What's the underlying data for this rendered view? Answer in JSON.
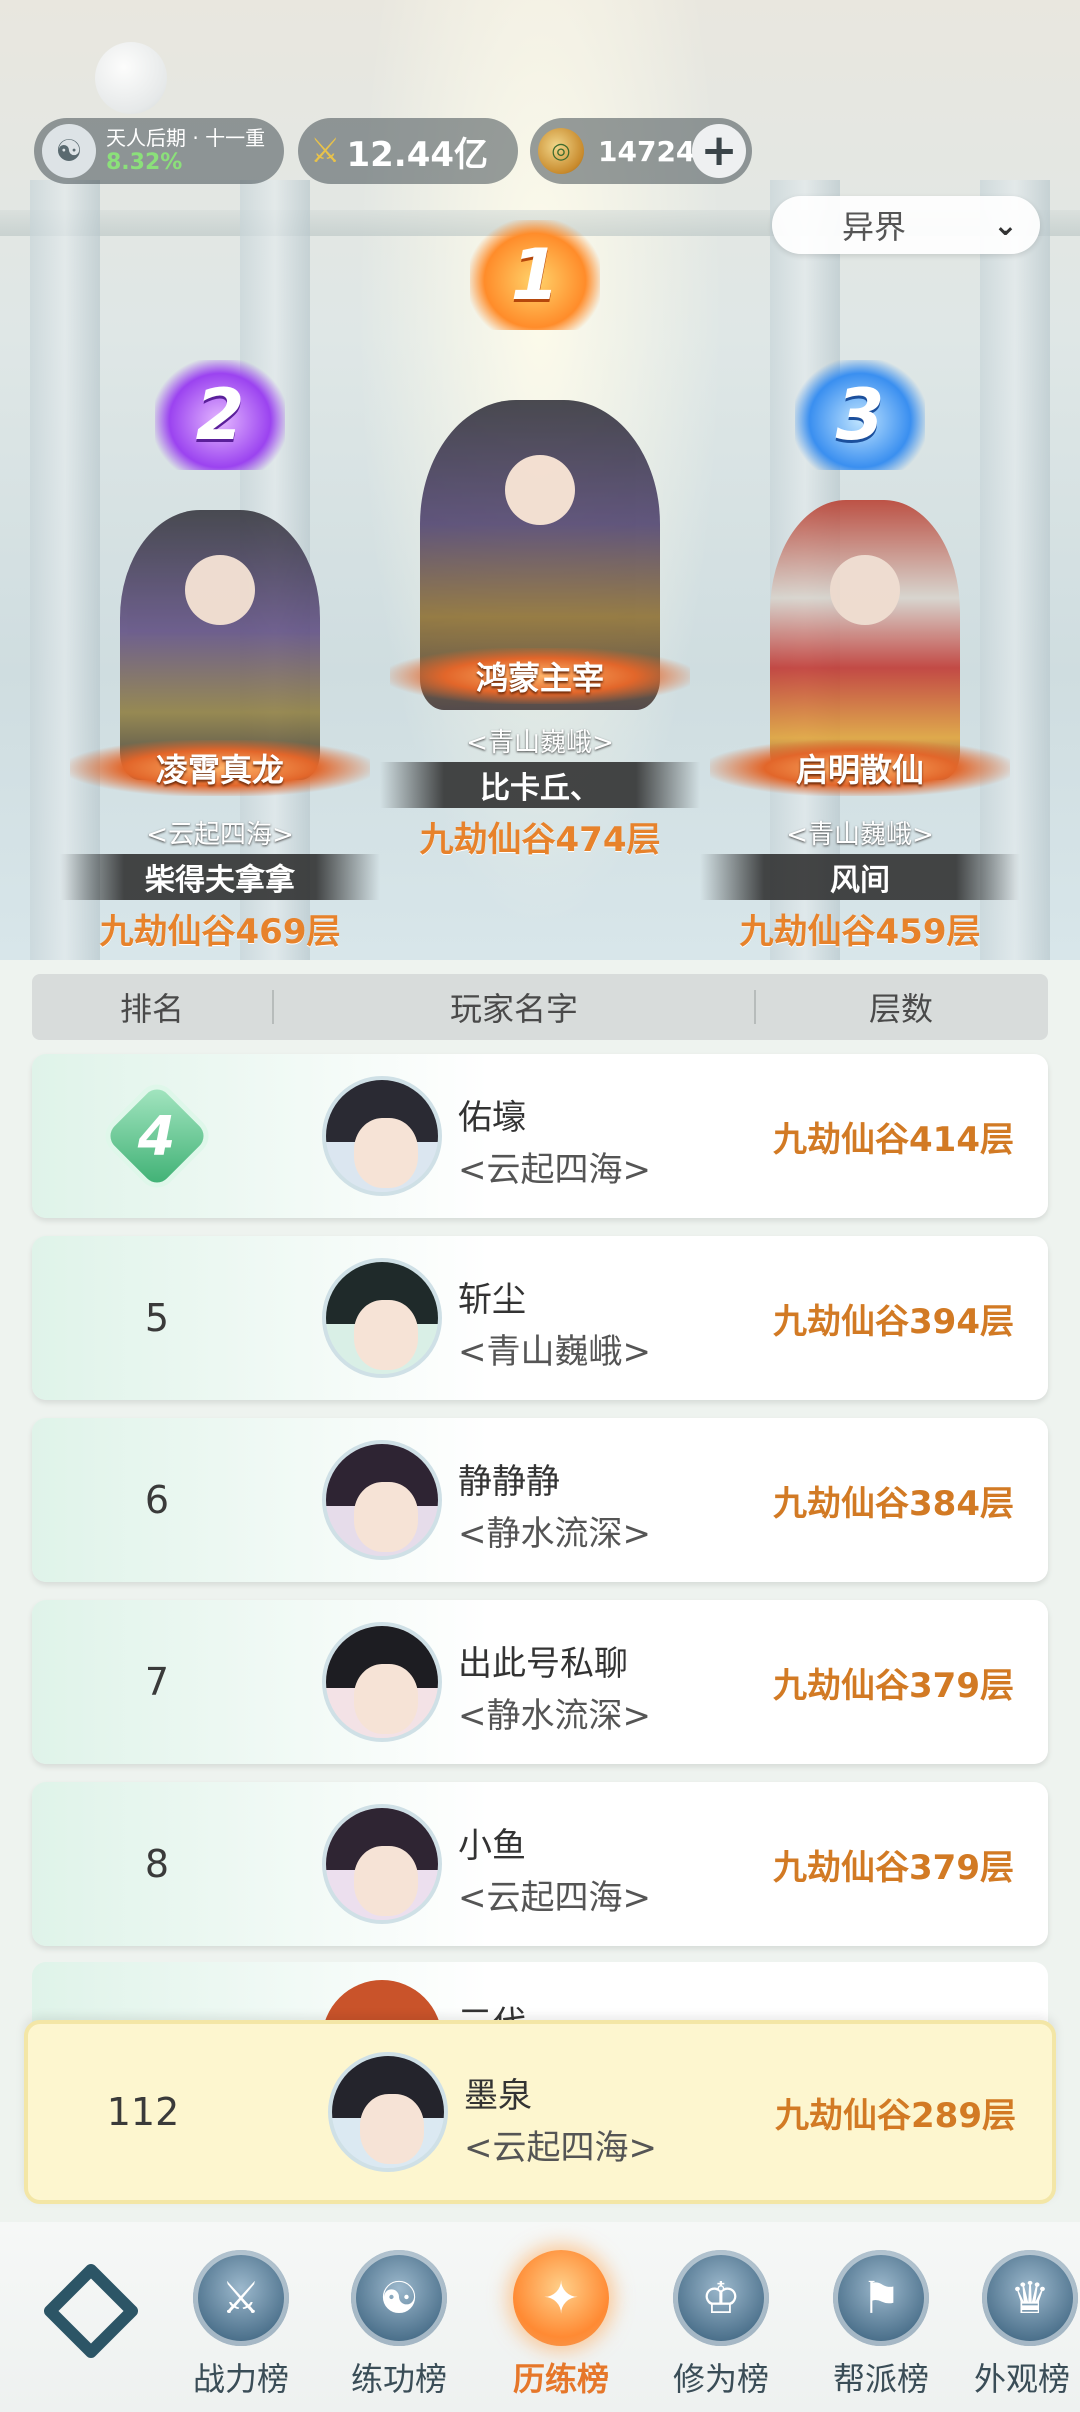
{
  "header": {
    "realm_name": "天人后期 · 十一重",
    "realm_percent": "8.32%",
    "power_value": "12.44亿",
    "currency_value": "14724",
    "add_currency_label": "+",
    "region_selected": "异界"
  },
  "podium": [
    {
      "rank": "1",
      "title": "鸿蒙主宰",
      "guild": "<青山巍峨>",
      "name": "比卡丘、",
      "floor": "九劫仙谷474层"
    },
    {
      "rank": "2",
      "title": "凌霄真龙",
      "guild": "<云起四海>",
      "name": "柴得夫拿拿",
      "floor": "九劫仙谷469层"
    },
    {
      "rank": "3",
      "title": "启明散仙",
      "guild": "<青山巍峨>",
      "name": "风间",
      "floor": "九劫仙谷459层"
    }
  ],
  "table": {
    "headers": [
      "排名",
      "玩家名字",
      "层数"
    ],
    "rows": [
      {
        "rank": "4",
        "name": "佑壕",
        "guild": "<云起四海>",
        "floor": "九劫仙谷414层"
      },
      {
        "rank": "5",
        "name": "斩尘",
        "guild": "<青山巍峨>",
        "floor": "九劫仙谷394层"
      },
      {
        "rank": "6",
        "name": "静静静",
        "guild": "<静水流深>",
        "floor": "九劫仙谷384层"
      },
      {
        "rank": "7",
        "name": "出此号私聊",
        "guild": "<静水流深>",
        "floor": "九劫仙谷379层"
      },
      {
        "rank": "8",
        "name": "小鱼",
        "guild": "<云起四海>",
        "floor": "九劫仙谷379层"
      }
    ],
    "partial_row_name": "三代"
  },
  "self_row": {
    "rank": "112",
    "name": "墨泉",
    "guild": "<云起四海>",
    "floor": "九劫仙谷289层"
  },
  "nav": {
    "tabs": [
      {
        "label": "战力榜",
        "icon": "swords-icon"
      },
      {
        "label": "练功榜",
        "icon": "yin-yang-icon"
      },
      {
        "label": "历练榜",
        "icon": "star-compass-icon"
      },
      {
        "label": "修为榜",
        "icon": "scholar-hat-icon"
      },
      {
        "label": "帮派榜",
        "icon": "banner-icon"
      },
      {
        "label": "外观榜",
        "icon": "costume-icon"
      }
    ],
    "active_tab": "历练榜"
  },
  "colors": {
    "accent_orange": "#e6772a",
    "floor_text": "#d27a24",
    "self_row_bg": "#fdf6cf"
  }
}
